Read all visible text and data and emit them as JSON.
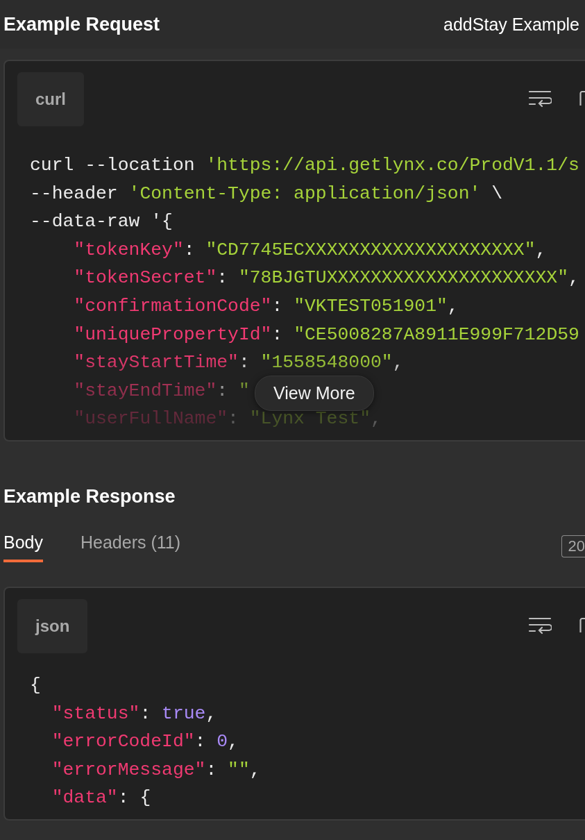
{
  "request": {
    "title": "Example Request",
    "example_name": "addStay Example",
    "language": "curl",
    "view_more": "View More",
    "lines": [
      {
        "tokens": [
          {
            "kind": "plain",
            "text": "curl --location "
          },
          {
            "kind": "string",
            "text": "'https://api.getlynx.co/ProdV1.1/s"
          }
        ]
      },
      {
        "tokens": [
          {
            "kind": "plain",
            "text": "--header "
          },
          {
            "kind": "string",
            "text": "'Content-Type: application/json'"
          },
          {
            "kind": "plain",
            "text": " \\"
          }
        ]
      },
      {
        "tokens": [
          {
            "kind": "plain",
            "text": "--data-raw '{"
          }
        ],
        "children": [
          {
            "tokens": [
              {
                "kind": "key",
                "text": "\"tokenKey\""
              },
              {
                "kind": "plain",
                "text": ": "
              },
              {
                "kind": "string",
                "text": "\"CD7745ECXXXXXXXXXXXXXXXXXXXX\""
              },
              {
                "kind": "plain",
                "text": ","
              }
            ]
          },
          {
            "tokens": [
              {
                "kind": "key",
                "text": "\"tokenSecret\""
              },
              {
                "kind": "plain",
                "text": ": "
              },
              {
                "kind": "string",
                "text": "\"78BJGTUXXXXXXXXXXXXXXXXXXXXX\""
              },
              {
                "kind": "plain",
                "text": ","
              }
            ]
          },
          {
            "tokens": [
              {
                "kind": "key",
                "text": "\"confirmationCode\""
              },
              {
                "kind": "plain",
                "text": ": "
              },
              {
                "kind": "string",
                "text": "\"VKTEST051901\""
              },
              {
                "kind": "plain",
                "text": ","
              }
            ]
          },
          {
            "tokens": [
              {
                "kind": "key",
                "text": "\"uniquePropertyId\""
              },
              {
                "kind": "plain",
                "text": ": "
              },
              {
                "kind": "string",
                "text": "\"CE5008287A8911E999F712D59"
              }
            ]
          },
          {
            "tokens": [
              {
                "kind": "key",
                "text": "\"stayStartTime\""
              },
              {
                "kind": "plain",
                "text": ": "
              },
              {
                "kind": "string",
                "text": "\"1558548000\""
              },
              {
                "kind": "plain",
                "text": ","
              }
            ]
          },
          {
            "tokens": [
              {
                "kind": "key",
                "text": "\"stayEndTime\""
              },
              {
                "kind": "plain",
                "text": ": "
              },
              {
                "kind": "string",
                "text": "\""
              }
            ]
          },
          {
            "tokens": [
              {
                "kind": "key",
                "text": "\"userFullName\""
              },
              {
                "kind": "plain",
                "text": ": "
              },
              {
                "kind": "string",
                "text": "\"Lynx Test\""
              },
              {
                "kind": "plain",
                "text": ","
              }
            ]
          }
        ]
      }
    ]
  },
  "response": {
    "title": "Example Response",
    "tabs": [
      {
        "label": "Body",
        "selected": true
      },
      {
        "label": "Headers (11)",
        "selected": false
      }
    ],
    "status_code": "20",
    "language": "json",
    "lines": [
      {
        "tokens": [
          {
            "kind": "plain",
            "text": "{"
          }
        ],
        "children": [
          {
            "tokens": [
              {
                "kind": "key",
                "text": "\"status\""
              },
              {
                "kind": "plain",
                "text": ": "
              },
              {
                "kind": "keyword",
                "text": "true"
              },
              {
                "kind": "plain",
                "text": ","
              }
            ]
          },
          {
            "tokens": [
              {
                "kind": "key",
                "text": "\"errorCodeId\""
              },
              {
                "kind": "plain",
                "text": ": "
              },
              {
                "kind": "number",
                "text": "0"
              },
              {
                "kind": "plain",
                "text": ","
              }
            ]
          },
          {
            "tokens": [
              {
                "kind": "key",
                "text": "\"errorMessage\""
              },
              {
                "kind": "plain",
                "text": ": "
              },
              {
                "kind": "string",
                "text": "\"\""
              },
              {
                "kind": "plain",
                "text": ","
              }
            ]
          },
          {
            "tokens": [
              {
                "kind": "key",
                "text": "\"data\""
              },
              {
                "kind": "plain",
                "text": ": {"
              }
            ]
          }
        ]
      }
    ]
  }
}
